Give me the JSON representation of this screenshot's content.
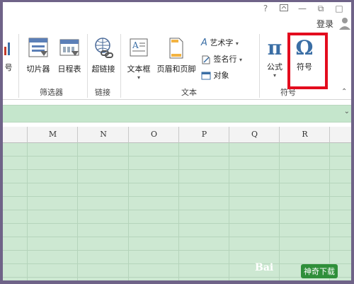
{
  "titlebar": {
    "help": "?",
    "restore": "⧉",
    "minimize": "—",
    "close": "□"
  },
  "account": {
    "login_label": "登录"
  },
  "ribbon": {
    "partial_left_label": "号",
    "slicer_label": "切片器",
    "timeline_label": "日程表",
    "hyperlink_label": "超链接",
    "textbox_label": "文本框",
    "header_footer_label": "页眉和页脚",
    "wordart_label": "艺术字",
    "signature_label": "签名行",
    "object_label": "对象",
    "equation_label": "公式",
    "symbol_label": "符号",
    "groups": {
      "filter": "筛选器",
      "links": "链接",
      "text": "文本",
      "symbols": "符号"
    }
  },
  "sheet": {
    "columns": [
      "M",
      "N",
      "O",
      "P",
      "Q",
      "R"
    ]
  },
  "watermark": {
    "text": "Bai",
    "site": "神奇下载"
  },
  "colors": {
    "highlight": "#e30c1e",
    "sheet_green": "#cde8d2",
    "border": "#6f6388"
  }
}
